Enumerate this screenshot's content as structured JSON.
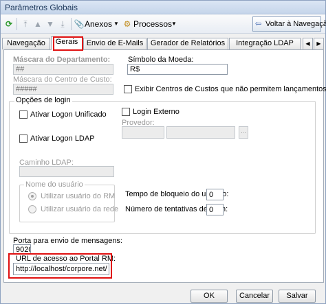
{
  "window": {
    "title": "Parâmetros Globais"
  },
  "toolbar": {
    "anexos_label": "Anexos",
    "processos_label": "Processos",
    "back_label": "Voltar à Navegação"
  },
  "tabs": [
    {
      "label": "Navegação"
    },
    {
      "label": "Gerais"
    },
    {
      "label": "Envio de E-Mails"
    },
    {
      "label": "Gerador de Relatórios"
    },
    {
      "label": "Integração LDAP"
    }
  ],
  "form": {
    "mascara_departamento": {
      "label": "Máscara do Departamento:",
      "value": "##"
    },
    "simbolo_moeda": {
      "label": "Símbolo da Moeda:",
      "value": "R$"
    },
    "mascara_centro_custo": {
      "label": "Máscara do Centro de Custo:",
      "value": "#####"
    },
    "exibir_centros": {
      "label": "Exibir Centros de Custos que não permitem lançamentos"
    },
    "opcoes_login": {
      "title": "Opções de login",
      "logon_unificado": "Ativar Logon Unificado",
      "login_externo": "Login Externo",
      "provedor": "Provedor:",
      "provedor_button": "...",
      "logon_ldap": "Ativar Logon LDAP",
      "caminho_ldap": "Caminho LDAP:",
      "nome_usuario": {
        "title": "Nome do usuário",
        "opt_rm": "Utilizar usuário do RM",
        "opt_rede": "Utilizar usuário da rede"
      },
      "tempo_bloqueio": {
        "label": "Tempo de bloqueio do usuário:",
        "value": "0"
      },
      "tentativas": {
        "label": "Número de tentativas de login:",
        "value": "0"
      }
    },
    "porta": {
      "label": "Porta para envio de mensagens:",
      "value": "9020"
    },
    "url_portal": {
      "label": "URL de acesso ao Portal RM:",
      "value": "http://localhost/corpore.net/"
    }
  },
  "footer": {
    "ok": "OK",
    "cancel": "Cancelar",
    "save": "Salvar"
  },
  "colors": {
    "highlight": "#e01010",
    "accent": "#1e395b"
  }
}
